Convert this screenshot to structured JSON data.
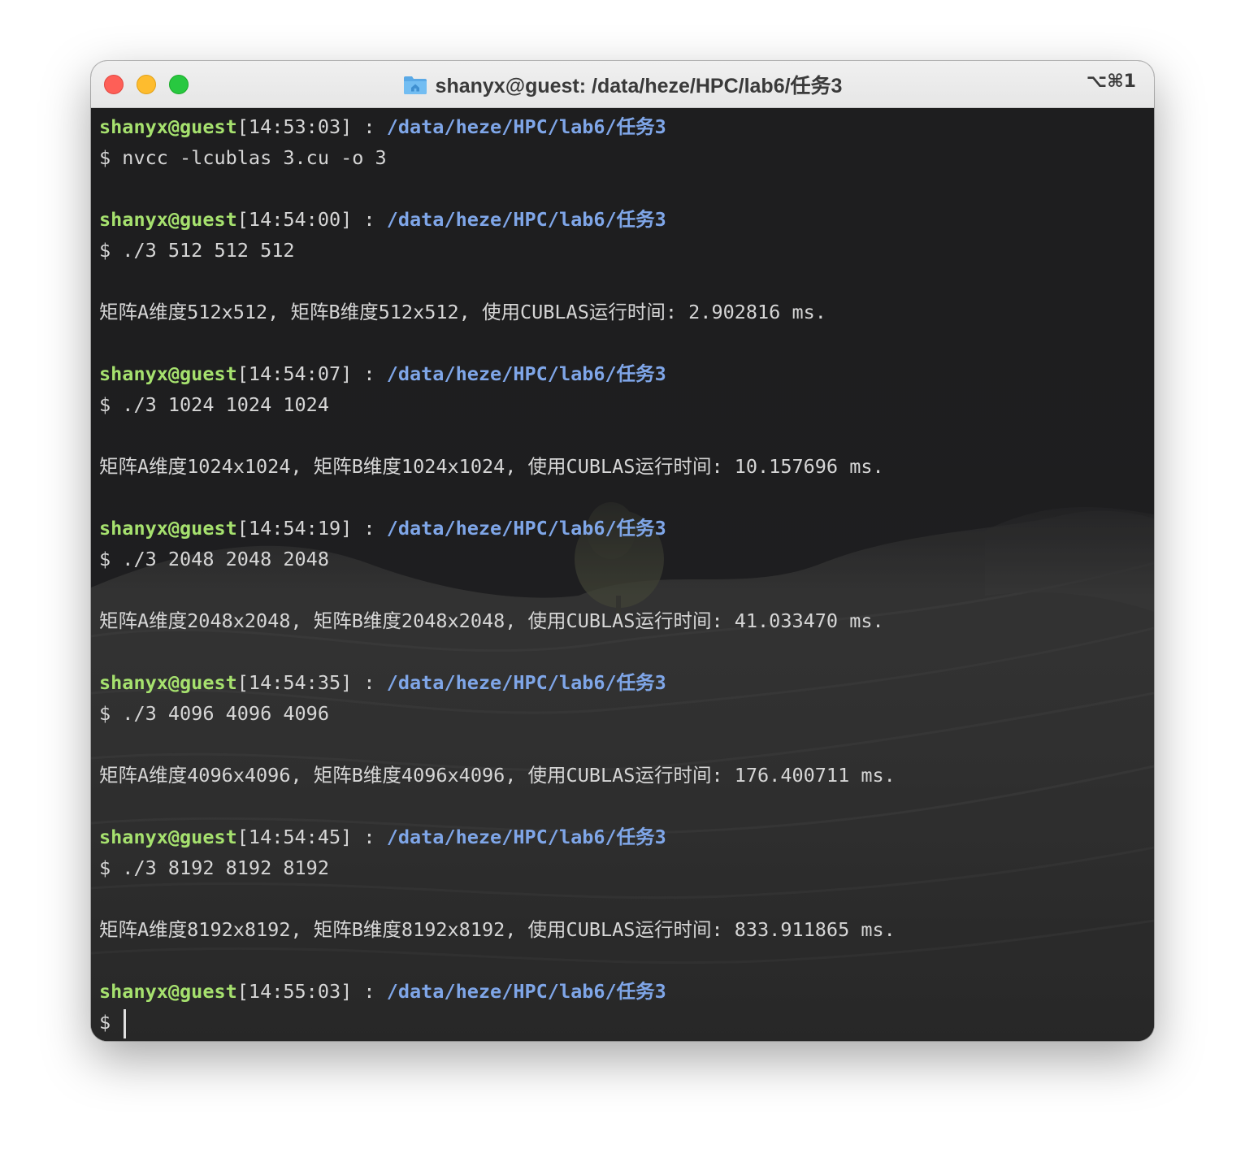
{
  "window": {
    "title": "shanyx@guest: /data/heze/HPC/lab6/任务3",
    "shortcut": "⌥⌘1"
  },
  "colors": {
    "user": "#a6e16e",
    "path": "#7fa6e8",
    "text": "#d6d6d6",
    "terminal_bg": "#1f1f21",
    "close": "#fe5f57",
    "minimize": "#febc2e",
    "maximize": "#28c840"
  },
  "terminal": {
    "blocks": [
      {
        "user": "shanyx@guest",
        "time": "[14:53:03]",
        "sep": " : ",
        "path": "/data/heze/HPC/lab6/任务3",
        "command": "$ nvcc -lcublas 3.cu -o 3",
        "output": ""
      },
      {
        "user": "shanyx@guest",
        "time": "[14:54:00]",
        "sep": " : ",
        "path": "/data/heze/HPC/lab6/任务3",
        "command": "$ ./3 512 512 512",
        "output": "矩阵A维度512x512, 矩阵B维度512x512, 使用CUBLAS运行时间: 2.902816 ms."
      },
      {
        "user": "shanyx@guest",
        "time": "[14:54:07]",
        "sep": " : ",
        "path": "/data/heze/HPC/lab6/任务3",
        "command": "$ ./3 1024 1024 1024",
        "output": "矩阵A维度1024x1024, 矩阵B维度1024x1024, 使用CUBLAS运行时间: 10.157696 ms."
      },
      {
        "user": "shanyx@guest",
        "time": "[14:54:19]",
        "sep": " : ",
        "path": "/data/heze/HPC/lab6/任务3",
        "command": "$ ./3 2048 2048 2048",
        "output": "矩阵A维度2048x2048, 矩阵B维度2048x2048, 使用CUBLAS运行时间: 41.033470 ms."
      },
      {
        "user": "shanyx@guest",
        "time": "[14:54:35]",
        "sep": " : ",
        "path": "/data/heze/HPC/lab6/任务3",
        "command": "$ ./3 4096 4096 4096",
        "output": "矩阵A维度4096x4096, 矩阵B维度4096x4096, 使用CUBLAS运行时间: 176.400711 ms."
      },
      {
        "user": "shanyx@guest",
        "time": "[14:54:45]",
        "sep": " : ",
        "path": "/data/heze/HPC/lab6/任务3",
        "command": "$ ./3 8192 8192 8192",
        "output": "矩阵A维度8192x8192, 矩阵B维度8192x8192, 使用CUBLAS运行时间: 833.911865 ms."
      },
      {
        "user": "shanyx@guest",
        "time": "[14:55:03]",
        "sep": " : ",
        "path": "/data/heze/HPC/lab6/任务3",
        "command": "$ ",
        "output": null
      }
    ]
  }
}
